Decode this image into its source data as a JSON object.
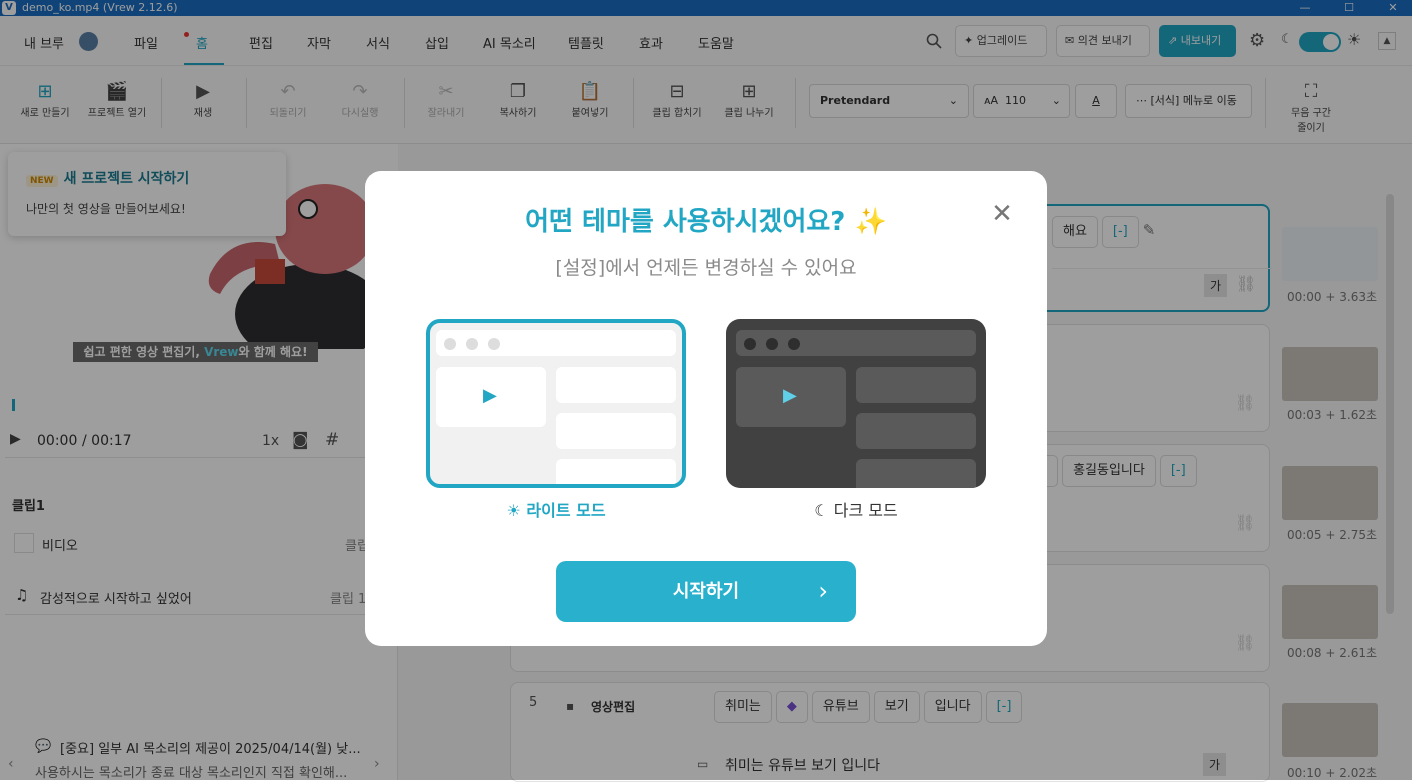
{
  "window": {
    "title": "demo_ko.mp4 (Vrew 2.12.6)",
    "app_icon": "V",
    "minimize": "—",
    "maximize": "☐",
    "close": "✕"
  },
  "menu": {
    "user": "내 브루",
    "items": [
      "파일",
      "홈",
      "편집",
      "자막",
      "서식",
      "삽입",
      "AI 목소리",
      "템플릿",
      "효과",
      "도움말"
    ],
    "upgrade": "업그레이드",
    "feedback": "의견 보내기",
    "export": "내보내기"
  },
  "toolbar": {
    "new": "새로 만들기",
    "open": "프로젝트 열기",
    "play": "재생",
    "undo": "되돌리기",
    "redo": "다시실행",
    "cut": "잘라내기",
    "copy": "복사하기",
    "paste": "붙여넣기",
    "merge": "클립 합치기",
    "split": "클립 나누기",
    "font": "Pretendard",
    "font_size": "110",
    "text_color": "A",
    "format_menu": "[서식] 메뉴로 이동",
    "silence_1": "무음 구간",
    "silence_2": "줄이기"
  },
  "tooltip": {
    "badge": "NEW",
    "title": "새 프로젝트 시작하기",
    "body": "나만의 첫 영상을 만들어보세요!"
  },
  "preview": {
    "caption_a": "쉽고 편한 영상 편집기, ",
    "caption_b": "Vrew",
    "caption_c": "와 함께 해요!",
    "time": "00:00",
    "duration": "/ 00:17",
    "speed": "1x"
  },
  "clip_panel": {
    "title": "클립1",
    "video_label": "비디오",
    "video_col": "클립",
    "audio_label": "감성적으로 시작하고 싶었어",
    "audio_col": "클립 1"
  },
  "notice": {
    "title": "[중요] 일부 AI 목소리의 제공이 2025/04/14(월) 낮...",
    "body": "사용하시는 목소리가 종료 대상 목소리인지 직접 확인해..."
  },
  "clips": [
    {
      "num": "",
      "chips": [
        "해요",
        "[-]"
      ],
      "time": "00:00 + 3.63초"
    },
    {
      "num": "",
      "chips": [],
      "time": "00:03 + 1.62초"
    },
    {
      "num": "",
      "chips": [
        "]",
        "홍길동입니다",
        "[-]"
      ],
      "time": "00:05 + 2.75초"
    },
    {
      "num": "",
      "chips": [
        "",
        ""
      ],
      "time": "00:08 + 2.61초"
    },
    {
      "num": "5",
      "speaker": "영상편집",
      "chips": [
        "취미는",
        "유튜브",
        "보기",
        "입니다",
        "[-]"
      ],
      "subtitle": "취미는 유튜브 보기 입니다",
      "time": "00:10 + 2.02초"
    }
  ],
  "sub_badge": "가",
  "modal": {
    "title": "어떤 테마를 사용하시겠어요?",
    "sparkle": "✨",
    "subtitle": "[설정]에서 언제든 변경하실 수 있어요",
    "light_label": "라이트 모드",
    "dark_label": "다크 모드",
    "start": "시작하기",
    "start_arrow": "›",
    "close": "✕"
  },
  "colors": {
    "accent": "#21a6c4",
    "titlebar": "#1a6ec2",
    "dark_theme": "#414141"
  },
  "icons": [
    "search-icon",
    "sparkle-icon",
    "mail-icon",
    "export-icon",
    "gear-icon",
    "moon-icon",
    "sun-icon",
    "close-icon",
    "play-icon",
    "chevron-right-icon"
  ]
}
